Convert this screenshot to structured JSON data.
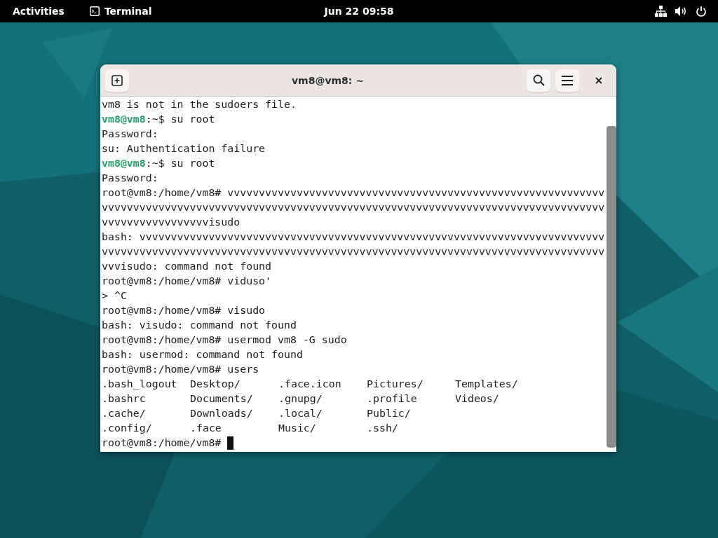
{
  "top_bar": {
    "activities": "Activities",
    "app": "Terminal",
    "clock": "Jun 22  09:58"
  },
  "window": {
    "title": "vm8@vm8: ~"
  },
  "terminal": {
    "lines": [
      {
        "kind": "plain",
        "text": "vm8 is not in the sudoers file."
      },
      {
        "kind": "prompt",
        "user": "vm8@vm8",
        "rest": ":~$ ",
        "text": "su root"
      },
      {
        "kind": "plain",
        "text": "Password:"
      },
      {
        "kind": "plain",
        "text": "su: Authentication failure"
      },
      {
        "kind": "prompt",
        "user": "vm8@vm8",
        "rest": ":~$ ",
        "text": "su root"
      },
      {
        "kind": "plain",
        "text": "Password:"
      },
      {
        "kind": "plain",
        "text": "root@vm8:/home/vm8# vvvvvvvvvvvvvvvvvvvvvvvvvvvvvvvvvvvvvvvvvvvvvvvvvvvvvvvvvvvv"
      },
      {
        "kind": "plain",
        "text": "vvvvvvvvvvvvvvvvvvvvvvvvvvvvvvvvvvvvvvvvvvvvvvvvvvvvvvvvvvvvvvvvvvvvvvvvvvvvvvvv"
      },
      {
        "kind": "plain",
        "text": "vvvvvvvvvvvvvvvvvisudo"
      },
      {
        "kind": "plain",
        "text": "bash: vvvvvvvvvvvvvvvvvvvvvvvvvvvvvvvvvvvvvvvvvvvvvvvvvvvvvvvvvvvvvvvvvvvvvvvvvv"
      },
      {
        "kind": "plain",
        "text": "vvvvvvvvvvvvvvvvvvvvvvvvvvvvvvvvvvvvvvvvvvvvvvvvvvvvvvvvvvvvvvvvvvvvvvvvvvvvvvvv"
      },
      {
        "kind": "plain",
        "text": "vvvisudo: command not found"
      },
      {
        "kind": "plain",
        "text": "root@vm8:/home/vm8# viduso'"
      },
      {
        "kind": "plain",
        "text": "> ^C"
      },
      {
        "kind": "plain",
        "text": "root@vm8:/home/vm8# visudo"
      },
      {
        "kind": "plain",
        "text": "bash: visudo: command not found"
      },
      {
        "kind": "plain",
        "text": "root@vm8:/home/vm8# usermod vm8 -G sudo"
      },
      {
        "kind": "plain",
        "text": "bash: usermod: command not found"
      },
      {
        "kind": "plain",
        "text": "root@vm8:/home/vm8# users"
      },
      {
        "kind": "listing",
        "cells": [
          ".bash_logout",
          "Desktop/",
          ".face.icon",
          "Pictures/",
          "Templates/"
        ]
      },
      {
        "kind": "listing",
        "cells": [
          ".bashrc",
          "Documents/",
          ".gnupg/",
          ".profile",
          "Videos/"
        ]
      },
      {
        "kind": "listing",
        "cells": [
          ".cache/",
          "Downloads/",
          ".local/",
          "Public/"
        ]
      },
      {
        "kind": "listing",
        "cells": [
          ".config/",
          ".face",
          "Music/",
          ".ssh/"
        ]
      },
      {
        "kind": "cursor",
        "text": "root@vm8:/home/vm8# "
      }
    ]
  }
}
